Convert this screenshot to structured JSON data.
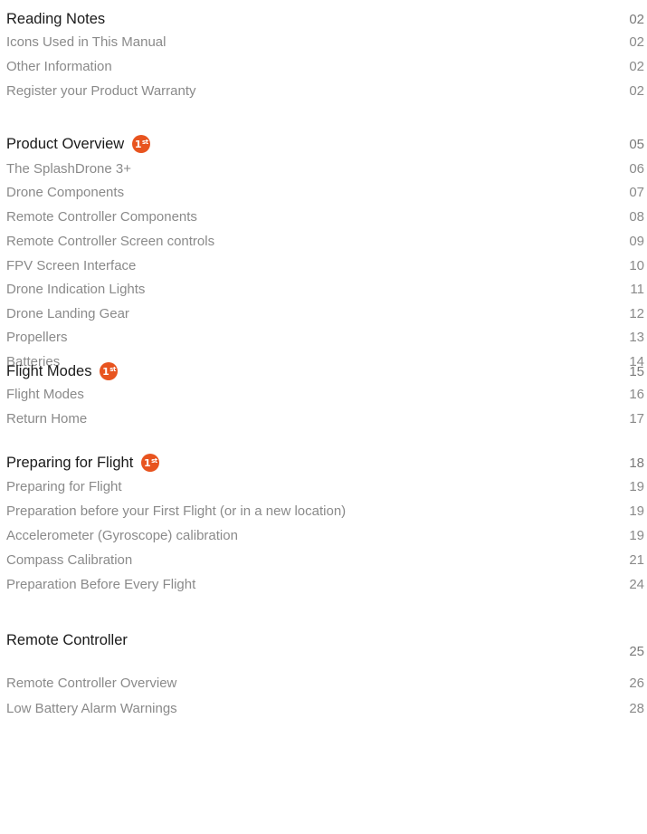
{
  "sections": [
    {
      "title": "Reading Notes",
      "page": "02",
      "badge": "",
      "items": [
        {
          "label": "Icons Used in This Manual",
          "page": "02"
        },
        {
          "label": "Other Information",
          "page": "02"
        },
        {
          "label": "Register your Product Warranty",
          "page": "02"
        }
      ]
    },
    {
      "title": "Product Overview",
      "page": "05",
      "badge": "1st",
      "items": [
        {
          "label": "The SplashDrone 3+",
          "page": "06"
        },
        {
          "label": "Drone Components",
          "page": "07"
        },
        {
          "label": "Remote Controller Components",
          "page": "08"
        },
        {
          "label": "Remote Controller Screen controls",
          "page": "09"
        },
        {
          "label": "FPV Screen Interface",
          "page": "10"
        },
        {
          "label": "Drone Indication Lights",
          "page": "11"
        },
        {
          "label": "Drone Landing Gear",
          "page": "12"
        },
        {
          "label": "Propellers",
          "page": "13"
        },
        {
          "label": "Batteries",
          "page": "14"
        }
      ]
    },
    {
      "title": "Flight Modes",
      "page": "15",
      "badge": "1st",
      "items": [
        {
          "label": "Flight Modes",
          "page": "16"
        },
        {
          "label": "Return Home",
          "page": "17"
        }
      ]
    },
    {
      "title": "Preparing for Flight",
      "page": "18",
      "badge": "1st",
      "items": [
        {
          "label": "Preparing for Flight",
          "page": "19"
        },
        {
          "label": "Preparation before your First Flight (or in a new location)",
          "page": "19"
        },
        {
          "label": "Accelerometer (Gyroscope) calibration",
          "page": "19"
        },
        {
          "label": "Compass Calibration",
          "page": "21"
        },
        {
          "label": "Preparation Before Every Flight",
          "page": "24"
        }
      ]
    },
    {
      "title": "Remote Controller",
      "page": "25",
      "badge": "",
      "items": [
        {
          "label": "Remote Controller Overview",
          "page": "26"
        },
        {
          "label": "Low Battery Alarm Warnings",
          "page": "28"
        }
      ]
    }
  ],
  "colors": {
    "badge": "#e8541f",
    "heading": "#1a1a1a",
    "entry": "#8a8a8a",
    "divider": "#d0d0d0"
  }
}
